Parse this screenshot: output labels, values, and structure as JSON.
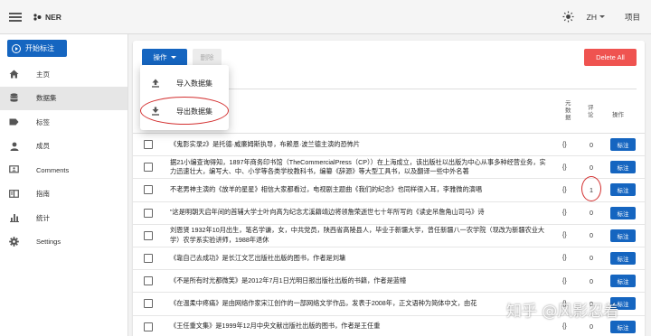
{
  "app": {
    "title": "NER"
  },
  "header": {
    "lang": "ZH",
    "projects": "项目"
  },
  "sidebar": {
    "start_button": "开始标注",
    "items": [
      {
        "label": "主页",
        "icon": "home-icon"
      },
      {
        "label": "数据集",
        "icon": "database-icon",
        "active": true
      },
      {
        "label": "标签",
        "icon": "label-icon"
      },
      {
        "label": "成员",
        "icon": "person-icon"
      },
      {
        "label": "Comments",
        "icon": "comment-icon"
      },
      {
        "label": "指南",
        "icon": "book-icon"
      },
      {
        "label": "统计",
        "icon": "bar-chart-icon"
      },
      {
        "label": "Settings",
        "icon": "gear-icon"
      }
    ]
  },
  "toolbar": {
    "ops_label": "操作",
    "delete_label": "删除",
    "delete_all_label": "Delete All"
  },
  "menu": {
    "import_label": "导入数据集",
    "export_label": "导出数据集"
  },
  "table": {
    "col_meta": "元\n数\n据",
    "col_comments": "评\n论",
    "col_action": "操作",
    "tag_label": "标注",
    "rows": [
      {
        "text": "《鬼影实录2》是托德·威廉姆斯执导，布赖恩·波兰德主演的恐怖片",
        "meta": "{}",
        "comments": "0"
      },
      {
        "text": "据21小编查询得知，1897年商务印书馆（TheCommercialPress（CP））在上海成立，该出版社以出版为中心从事多种经营业务，实力迅速壮大，编写大、中、小学等各类学校教科书，编纂《辞源》等大型工具书，以及翻译一些中外名著",
        "meta": "{}",
        "comments": "0"
      },
      {
        "text": "不老男神主演的《放羊的星星》相信大家都看过，电视剧主题曲《我们的纪念》也同样很入耳，李雅微的演唱",
        "meta": "{}",
        "comments": "1"
      },
      {
        "text": "\"这是明朝天启年间的首辅大学士叶向高为纪念尤溪籍靖边将领詹荣逝世七十年所写的《读史吊詹角山司马》诗",
        "meta": "{}",
        "comments": "0"
      },
      {
        "text": "刘恩贤 1932年10月出生，笔名学谦，女，中共党员，陕西省高陵县人，毕业于新疆大学，曾任新疆八一农学院（现改为新疆农业大学）农学系实验讲师，1988年退休",
        "meta": "{}",
        "comments": "0"
      },
      {
        "text": "《靠自己去成功》是长江文艺出版社出版的图书，作者是刘墉",
        "meta": "{}",
        "comments": "0"
      },
      {
        "text": "《不是所有时光都微笑》是2012年7月1日光明日报出版社出版的书籍，作者是蓝幢",
        "meta": "{}",
        "comments": "0"
      },
      {
        "text": "《在温柔中疼痛》是由网络作家宋江创作的一部网络文学作品，发表于2008年，正文语种为简体中文，由花",
        "meta": "{}",
        "comments": "0"
      },
      {
        "text": "《王任重文集》是1999年12月中央文献出版社出版的图书，作者是王任重",
        "meta": "{}",
        "comments": "0"
      }
    ]
  },
  "watermark": "知乎 @风影忍着",
  "colors": {
    "primary": "#1565c0",
    "danger": "#ef5350",
    "annotation": "#d32f2f"
  }
}
